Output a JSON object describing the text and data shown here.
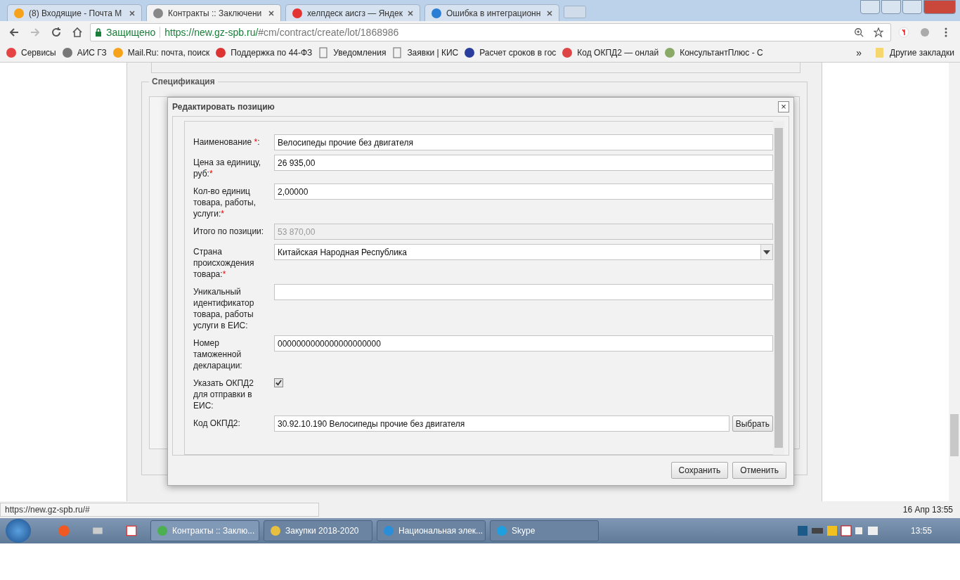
{
  "browser": {
    "tabs": [
      {
        "title": "(8) Входящие - Почта М",
        "selected": false
      },
      {
        "title": "Контракты :: Заключени",
        "selected": true
      },
      {
        "title": "хелпдеск аисгз — Яндек",
        "selected": false
      },
      {
        "title": "Ошибка в интеграционн",
        "selected": false
      }
    ],
    "secure_label": "Защищено",
    "url_host": "https://new.gz-spb.ru/",
    "url_path": "#cm/contract/create/lot/1868986",
    "bookmarks": [
      {
        "title": "Сервисы"
      },
      {
        "title": "АИС ГЗ"
      },
      {
        "title": "Mail.Ru: почта, поиск"
      },
      {
        "title": "Поддержка по 44-ФЗ"
      },
      {
        "title": "Уведомления"
      },
      {
        "title": "Заявки | КИС"
      },
      {
        "title": "Расчет сроков в гос"
      },
      {
        "title": "Код ОКПД2 — онлай"
      },
      {
        "title": "КонсультантПлюс - С"
      }
    ],
    "more": "»",
    "other_bookmarks": "Другие закладки"
  },
  "page": {
    "section_title": "Спецификация",
    "dialog": {
      "title": "Редактировать позицию",
      "close": "×",
      "fields": [
        {
          "kind": "text",
          "label": "Наименование ",
          "star": "*",
          "tail": ":",
          "value": "Велосипеды прочие без двигателя"
        },
        {
          "kind": "text",
          "label": "Цена за единицу, руб:",
          "star": "*",
          "value": "26 935,00"
        },
        {
          "kind": "text",
          "label": "Кол-во единиц товара, работы, услуги:",
          "star": "*",
          "value": "2,00000"
        },
        {
          "kind": "readonly",
          "label": "Итого по позиции:",
          "value": "53 870,00"
        },
        {
          "kind": "select",
          "label": "Страна происхождения товара:",
          "star": "*",
          "value": "Китайская Народная Республика"
        },
        {
          "kind": "text",
          "label": "Уникальный идентификатор товара, работы услуги в ЕИС:"
        },
        {
          "kind": "text",
          "label": "Номер таможенной декларации:",
          "value": "0000000000000000000000"
        },
        {
          "kind": "checkbox",
          "label": "Указать ОКПД2 для отправки в ЕИС:",
          "checked": true
        },
        {
          "kind": "picker",
          "label": "Код ОКПД2:",
          "value": "30.92.10.190 Велосипеды прочие без двигателя",
          "button": "Выбрать"
        }
      ],
      "buttons": [
        "Сохранить",
        "Отменить"
      ]
    }
  },
  "status_url": "https://new.gz-spb.ru/#",
  "datetime": "16 Апр 13:55",
  "taskbar": {
    "windows": [
      {
        "title": "Контракты :: Заклю...",
        "selected": true
      },
      {
        "title": "Закупки 2018-2020",
        "selected": false
      },
      {
        "title": "Национальная элек...",
        "selected": false
      },
      {
        "title": "Skype",
        "selected": false
      }
    ],
    "clock": "13:55"
  }
}
